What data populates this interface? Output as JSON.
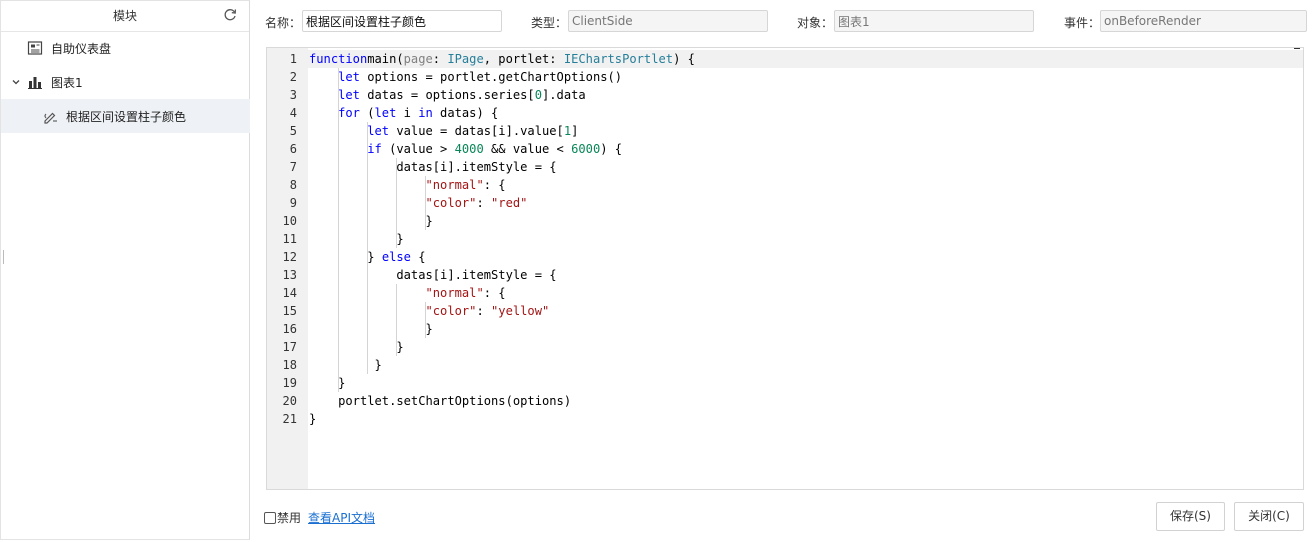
{
  "sidebar": {
    "title": "模块",
    "items": [
      {
        "label": "自助仪表盘",
        "icon": "dashboard-icon",
        "level": 0
      },
      {
        "label": "图表1",
        "icon": "bar-chart-icon",
        "level": 0,
        "expanded": true
      },
      {
        "label": "根据区间设置柱子颜色",
        "icon": "script-edit-icon",
        "level": 1,
        "selected": true
      }
    ]
  },
  "form": {
    "name_label": "名称：",
    "name_value": "根据区间设置柱子颜色",
    "type_label": "类型：",
    "type_value": "ClientSide",
    "target_label": "对象：",
    "target_value": "图表1",
    "event_label": "事件：",
    "event_value": "onBeforeRender"
  },
  "editor": {
    "lines": [
      {
        "n": "1",
        "tokens": [
          [
            "k",
            "function"
          ],
          [
            "",
            "main("
          ],
          [
            "p",
            "page"
          ],
          [
            "",
            ": "
          ],
          [
            "t",
            "IPage"
          ],
          [
            "",
            ", portlet: "
          ],
          [
            "t",
            "IEChartsPortlet"
          ],
          [
            "",
            ") {"
          ]
        ]
      },
      {
        "n": "2",
        "tokens": [
          [
            "",
            "    "
          ],
          [
            "k",
            "let"
          ],
          [
            "",
            " options = portlet.getChartOptions()"
          ]
        ]
      },
      {
        "n": "3",
        "tokens": [
          [
            "",
            "    "
          ],
          [
            "k",
            "let"
          ],
          [
            "",
            " datas = options.series["
          ],
          [
            "n",
            "0"
          ],
          [
            "",
            "].data"
          ]
        ]
      },
      {
        "n": "4",
        "tokens": [
          [
            "",
            "    "
          ],
          [
            "k",
            "for"
          ],
          [
            "",
            " ("
          ],
          [
            "k",
            "let"
          ],
          [
            "",
            "",
            " i "
          ],
          [
            "k",
            "in"
          ],
          [
            "",
            " datas) {"
          ]
        ]
      },
      {
        "n": "5",
        "tokens": [
          [
            "",
            "        "
          ],
          [
            "k",
            "let"
          ],
          [
            "",
            "",
            " value = datas[i].value["
          ],
          [
            "n",
            "1"
          ],
          [
            "",
            "]"
          ]
        ]
      },
      {
        "n": "6",
        "tokens": [
          [
            "",
            "        "
          ],
          [
            "k",
            "if"
          ],
          [
            "",
            " (value > "
          ],
          [
            "n",
            "4000"
          ],
          [
            "",
            " && value < "
          ],
          [
            "n",
            "6000"
          ],
          [
            "",
            ") {"
          ]
        ]
      },
      {
        "n": "7",
        "tokens": [
          [
            "",
            "            datas[i].itemStyle = {"
          ]
        ]
      },
      {
        "n": "8",
        "tokens": [
          [
            "",
            "                "
          ],
          [
            "s",
            "\"normal\""
          ],
          [
            "",
            ": {"
          ]
        ]
      },
      {
        "n": "9",
        "tokens": [
          [
            "",
            "                "
          ],
          [
            "s",
            "\"color\""
          ],
          [
            "",
            ": "
          ],
          [
            "s",
            "\"red\""
          ]
        ]
      },
      {
        "n": "10",
        "tokens": [
          [
            "",
            "                }"
          ]
        ]
      },
      {
        "n": "11",
        "tokens": [
          [
            "",
            "            }"
          ]
        ]
      },
      {
        "n": "12",
        "tokens": [
          [
            "",
            "        } "
          ],
          [
            "k",
            "else"
          ],
          [
            "",
            " {"
          ]
        ]
      },
      {
        "n": "13",
        "tokens": [
          [
            "",
            "            datas[i].itemStyle = {"
          ]
        ]
      },
      {
        "n": "14",
        "tokens": [
          [
            "",
            "                "
          ],
          [
            "s",
            "\"normal\""
          ],
          [
            "",
            ": {"
          ]
        ]
      },
      {
        "n": "15",
        "tokens": [
          [
            "",
            "                "
          ],
          [
            "s",
            "\"color\""
          ],
          [
            "",
            ": "
          ],
          [
            "s",
            "\"yellow\""
          ]
        ]
      },
      {
        "n": "16",
        "tokens": [
          [
            "",
            "                }"
          ]
        ]
      },
      {
        "n": "17",
        "tokens": [
          [
            "",
            "            }"
          ]
        ]
      },
      {
        "n": "18",
        "tokens": [
          [
            "",
            "         }"
          ]
        ]
      },
      {
        "n": "19",
        "tokens": [
          [
            "",
            "    }"
          ]
        ]
      },
      {
        "n": "20",
        "tokens": [
          [
            "",
            "    portlet.setChartOptions(options)"
          ]
        ]
      },
      {
        "n": "21",
        "tokens": [
          [
            "",
            "}"
          ]
        ]
      }
    ]
  },
  "footer": {
    "disable_label": "禁用",
    "disable_checked": false,
    "api_link": "查看API文档",
    "save_label": "保存(S)",
    "close_label": "关闭(C)"
  }
}
